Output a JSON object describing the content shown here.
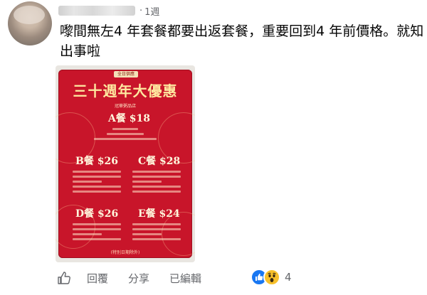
{
  "comment": {
    "author_name": "",
    "time_dot": "·",
    "time": "1週",
    "text": "嚟間無左4 年套餐都要出返套餐，重要回到4 年前價格。就知出事啦"
  },
  "poster": {
    "top_tag": "全日供應",
    "title": "三十週年大優惠",
    "subtitle": "冠華粥品店",
    "meals": [
      {
        "name": "A餐",
        "price": "$18"
      },
      {
        "name": "B餐",
        "price": "$26"
      },
      {
        "name": "C餐",
        "price": "$28"
      },
      {
        "name": "D餐",
        "price": "$26"
      },
      {
        "name": "E餐",
        "price": "$24"
      }
    ],
    "footer": "(特別日期除外)"
  },
  "actions": {
    "reply": "回覆",
    "share": "分享",
    "edited": "已編輯",
    "reaction_count": "4"
  },
  "colors": {
    "poster_red": "#c8152a",
    "muted_text": "#65676b",
    "like_blue": "#1877f2",
    "wow_yellow": "#f7c02b"
  },
  "icons": [
    "like-icon",
    "like-reaction-icon",
    "wow-reaction-icon"
  ]
}
